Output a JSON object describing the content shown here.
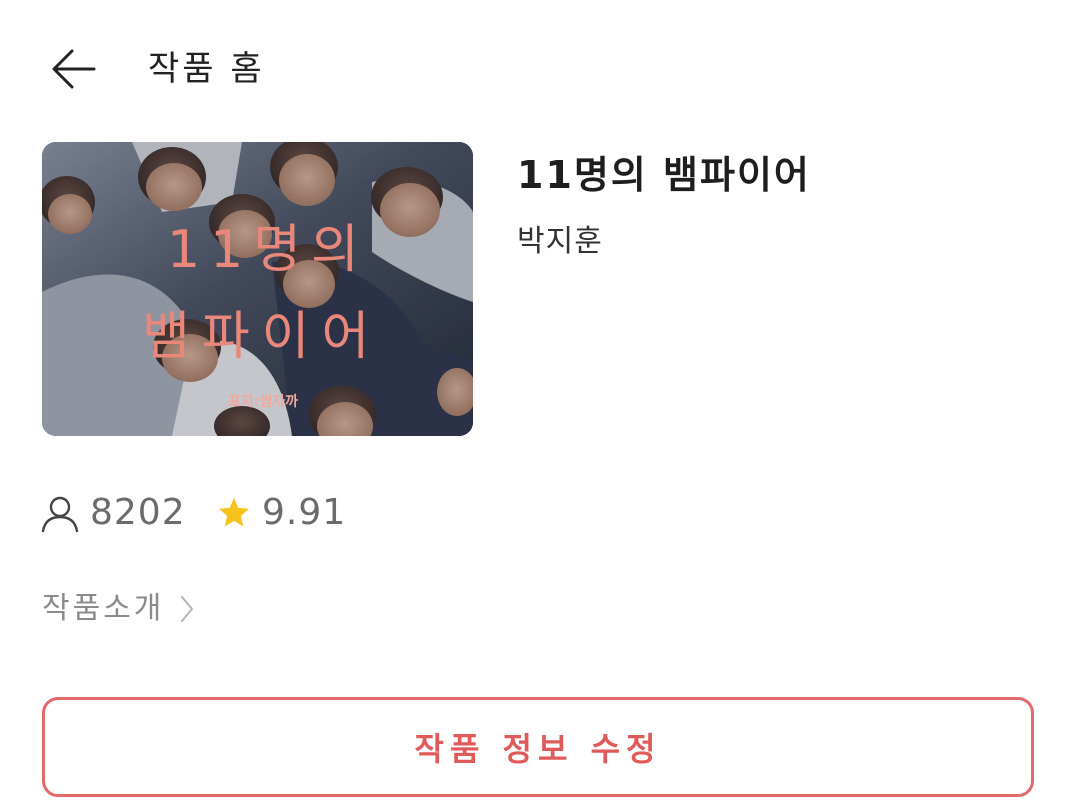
{
  "header": {
    "title": "작품 홈",
    "back_icon": "arrow-left-icon"
  },
  "book": {
    "cover_title_line1": "11명의",
    "cover_title_line2": "뱀파이어",
    "cover_credit": "표지:썸자까",
    "title": "11명의 뱀파이어",
    "author": "박지훈"
  },
  "stats": {
    "views_icon": "person-icon",
    "views": "8202",
    "rating_icon": "star-icon",
    "rating": "9.91"
  },
  "intro": {
    "label": "작품소개",
    "chevron_icon": "chevron-right-icon"
  },
  "actions": {
    "edit_label": "작품 정보 수정"
  },
  "colors": {
    "accent": "#e05a5a",
    "star": "#f7c21b",
    "muted": "#8b8b8b",
    "cover_text": "#e8877a"
  }
}
